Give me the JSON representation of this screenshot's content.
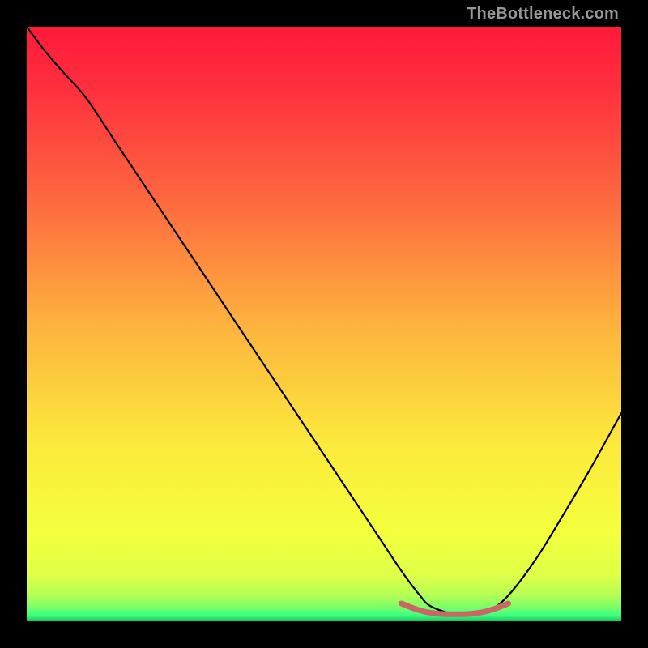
{
  "watermark": "TheBottleneck.com",
  "colors": {
    "background": "#000000",
    "curve_main": "#000000",
    "curve_accent": "#CC6666",
    "gradient_stops": [
      {
        "offset": 0.0,
        "color": "#FF1A3A"
      },
      {
        "offset": 0.1,
        "color": "#FF2E3E"
      },
      {
        "offset": 0.3,
        "color": "#FE6B3F"
      },
      {
        "offset": 0.5,
        "color": "#FDB23E"
      },
      {
        "offset": 0.7,
        "color": "#FCE93C"
      },
      {
        "offset": 0.85,
        "color": "#F4FF3D"
      },
      {
        "offset": 0.92,
        "color": "#E0FF46"
      },
      {
        "offset": 0.955,
        "color": "#B7FF55"
      },
      {
        "offset": 0.975,
        "color": "#7EFF66"
      },
      {
        "offset": 0.99,
        "color": "#3CFF80"
      },
      {
        "offset": 1.0,
        "color": "#14C75A"
      }
    ]
  },
  "chart_data": {
    "type": "line",
    "title": "",
    "xlabel": "",
    "ylabel": "",
    "xlim": [
      0,
      100
    ],
    "ylim": [
      0,
      100
    ],
    "series": [
      {
        "name": "bottleneck-curve",
        "x": [
          0,
          3,
          6,
          10,
          15,
          20,
          25,
          30,
          35,
          40,
          45,
          50,
          55,
          60,
          63,
          66,
          68,
          72,
          76,
          79,
          82,
          86,
          90,
          95,
          100
        ],
        "y": [
          100,
          96,
          92.5,
          88,
          80.5,
          73,
          65.5,
          58,
          50.5,
          43,
          35.5,
          28,
          20.5,
          13,
          8.5,
          4.5,
          2.5,
          1.2,
          1.2,
          2.5,
          5.5,
          11,
          17.5,
          26,
          35
        ]
      },
      {
        "name": "trough-accent",
        "x": [
          63,
          65,
          67,
          69,
          71,
          73,
          75,
          77,
          79,
          81
        ],
        "y": [
          3.0,
          2.2,
          1.6,
          1.3,
          1.2,
          1.2,
          1.3,
          1.6,
          2.2,
          3.0
        ]
      }
    ]
  }
}
